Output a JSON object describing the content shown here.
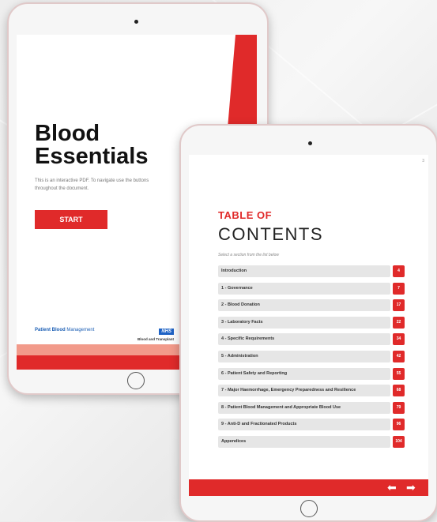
{
  "cover": {
    "title_line1": "Blood",
    "title_line2": "Essentials",
    "description": "This is an interactive PDF. To navigate use the buttons throughout the document.",
    "start_label": "START",
    "footer_left_bold": "Patient Blood",
    "footer_left_rest": " Management",
    "nhs_logo": "NHS",
    "nhs_sub": "Blood and Transplant"
  },
  "contents": {
    "page_number": "3",
    "heading_line1": "TABLE OF",
    "heading_line2": "CONTENTS",
    "instruction": "Select a section from the list below",
    "items": [
      {
        "label": "Introduction",
        "page": "4"
      },
      {
        "label": "1 - Governance",
        "page": "7"
      },
      {
        "label": "2 - Blood Donation",
        "page": "17"
      },
      {
        "label": "3 - Laboratory Facts",
        "page": "22"
      },
      {
        "label": "4 - Specific Requirements",
        "page": "34"
      },
      {
        "label": "5 - Administration",
        "page": "42"
      },
      {
        "label": "6 - Patient Safety and Reporting",
        "page": "55"
      },
      {
        "label": "7 - Major Haemorrhage, Emergency Preparedness and Resilience",
        "page": "68"
      },
      {
        "label": "8 - Patient Blood Management and Appropriate Blood Use",
        "page": "79"
      },
      {
        "label": "9 - Anti-D and Fractionated Products",
        "page": "96"
      },
      {
        "label": "Appendices",
        "page": "104"
      }
    ],
    "prev_arrow": "⬅",
    "next_arrow": "➡"
  },
  "colors": {
    "accent_red": "#e02a2a",
    "nhs_blue": "#1f63c5"
  }
}
